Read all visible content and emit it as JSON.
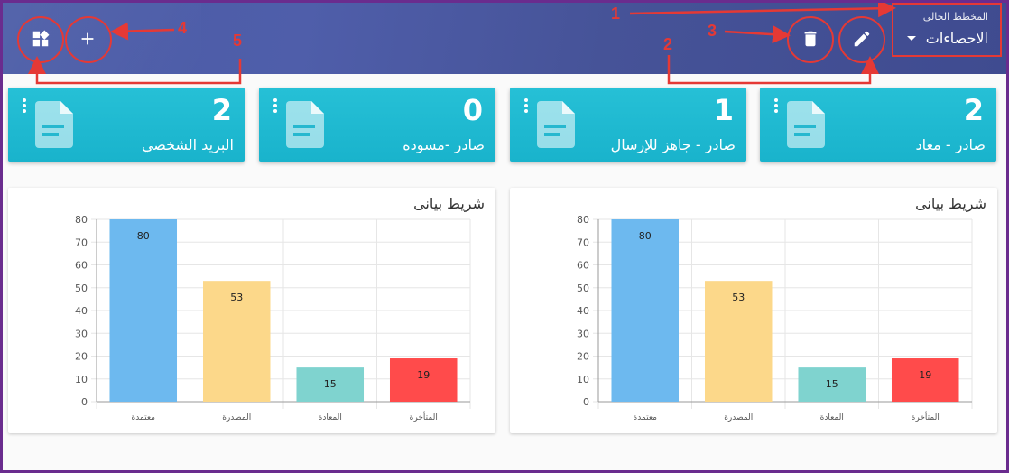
{
  "header": {
    "selector_label": "المخطط الحالى",
    "selector_value": "الاحصاءات"
  },
  "annotations": [
    "1",
    "2",
    "3",
    "4",
    "5"
  ],
  "cards": [
    {
      "count": "2",
      "title": "صادر - معاد"
    },
    {
      "count": "1",
      "title": "صادر - جاهز للإرسال"
    },
    {
      "count": "0",
      "title": "صادر -مسوده"
    },
    {
      "count": "2",
      "title": "البريد الشخصي"
    }
  ],
  "panels": [
    {
      "title": "شريط بيانى"
    },
    {
      "title": "شريط بيانى"
    }
  ],
  "chart_data": [
    {
      "type": "bar",
      "title": "شريط بيانى",
      "categories": [
        "معتمدة",
        "المصدرة",
        "المعادة",
        "المتأخرة"
      ],
      "values": [
        80,
        53,
        15,
        19
      ],
      "colors": [
        "#6db9ef",
        "#fcd88a",
        "#7fd3cf",
        "#ff4b4b"
      ],
      "ylim": [
        0,
        80
      ],
      "yticks": [
        0,
        10,
        20,
        30,
        40,
        50,
        60,
        70,
        80
      ],
      "grid": true
    },
    {
      "type": "bar",
      "title": "شريط بيانى",
      "categories": [
        "معتمدة",
        "المصدرة",
        "المعادة",
        "المتأخرة"
      ],
      "values": [
        80,
        53,
        15,
        19
      ],
      "colors": [
        "#6db9ef",
        "#fcd88a",
        "#7fd3cf",
        "#ff4b4b"
      ],
      "ylim": [
        0,
        80
      ],
      "yticks": [
        0,
        10,
        20,
        30,
        40,
        50,
        60,
        70,
        80
      ],
      "grid": true
    }
  ]
}
